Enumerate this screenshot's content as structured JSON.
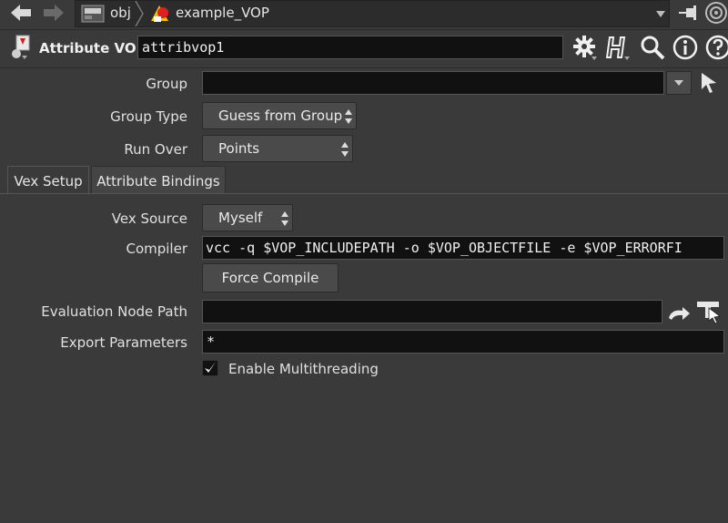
{
  "path": {
    "segments": [
      {
        "label": "obj",
        "icon": "obj-network-icon"
      },
      {
        "label": "example_VOP",
        "icon": "geometry-node-icon"
      }
    ]
  },
  "node": {
    "type_label": "Attribute VOP",
    "name": "attribvop1",
    "icon": "attribute-vop-icon"
  },
  "header_icons": [
    "gear-icon",
    "help-h-icon",
    "search-icon",
    "info-icon",
    "question-icon"
  ],
  "params": {
    "group": {
      "label": "Group",
      "value": ""
    },
    "group_type": {
      "label": "Group Type",
      "value": "Guess from Group"
    },
    "run_over": {
      "label": "Run Over",
      "value": "Points"
    }
  },
  "tabs": [
    {
      "label": "Vex Setup",
      "active": true
    },
    {
      "label": "Attribute Bindings",
      "active": false
    }
  ],
  "vex": {
    "vex_source": {
      "label": "Vex Source",
      "value": "Myself"
    },
    "compiler": {
      "label": "Compiler",
      "value": "vcc -q $VOP_INCLUDEPATH -o $VOP_OBJECTFILE -e $VOP_ERRORFI"
    },
    "force_compile": {
      "label": "Force Compile"
    },
    "eval_node_path": {
      "label": "Evaluation Node Path",
      "value": ""
    },
    "export_params": {
      "label": "Export Parameters",
      "value": "*"
    },
    "multithreading": {
      "label": "Enable Multithreading",
      "checked": true
    }
  },
  "colors": {
    "background": "#3a3a3a",
    "field": "#111111",
    "button": "#4a4a4a"
  }
}
